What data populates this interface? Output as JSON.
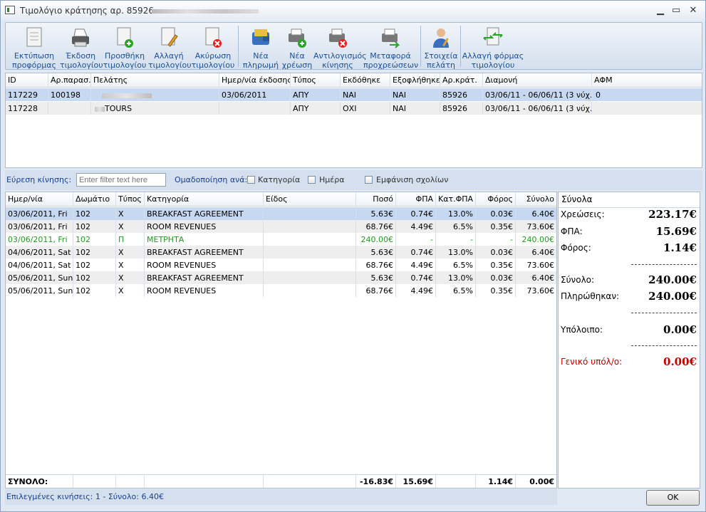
{
  "window": {
    "title": "Τιμολόγιο κράτησης αρ. 85926 -"
  },
  "toolbar": {
    "buttons": [
      {
        "line1": "Εκτύπωση",
        "line2": "προφόρμας"
      },
      {
        "line1": "Έκδοση",
        "line2": "τιμολογίου"
      },
      {
        "line1": "Προσθήκη",
        "line2": "τιμολογίου"
      },
      {
        "line1": "Αλλαγή",
        "line2": "τιμολογίου"
      },
      {
        "line1": "Ακύρωση",
        "line2": "τιμολογίου"
      },
      {
        "line1": "Νέα",
        "line2": "πληρωμή"
      },
      {
        "line1": "Νέα",
        "line2": "χρέωση"
      },
      {
        "line1": "Αντιλογισμός",
        "line2": "κίνησης"
      },
      {
        "line1": "Μεταφορά",
        "line2": "προχρεώσεων"
      },
      {
        "line1": "Στοιχεία",
        "line2": "πελάτη"
      },
      {
        "line1": "Αλλαγή φόρμας",
        "line2": "τιμολογίου"
      }
    ]
  },
  "invoices": {
    "headers": [
      "ID",
      "Αρ.παρασ.",
      "Πελάτης",
      "Ημερ/νία έκδοσης",
      "Τύπος",
      "Εκδόθηκε",
      "Εξοφλήθηκε",
      "Αρ.κράτ.",
      "Διαμονή",
      "ΑΦΜ"
    ],
    "rows": [
      [
        "117229",
        "100198",
        "",
        "03/06/2011",
        "ΑΠΥ",
        "ΝΑΙ",
        "ΝΑΙ",
        "85926",
        "03/06/11 - 06/06/11 (3 νύχ...",
        "0"
      ],
      [
        "117228",
        "",
        "TOURS",
        "",
        "ΑΠΥ",
        "ΟΧΙ",
        "ΝΑΙ",
        "85926",
        "03/06/11 - 06/06/11 (3 νύχ...",
        ""
      ]
    ]
  },
  "filter": {
    "search_label": "Εύρεση κίνησης:",
    "search_placeholder": "Enter filter text here",
    "group_label": "Ομαδοποίηση ανά:",
    "opt_category": "Κατηγορία",
    "opt_day": "Ημέρα",
    "opt_comments": "Εμφάνιση σχολίων"
  },
  "transactions": {
    "headers": [
      "Ημερ/νία",
      "Δωμάτιο",
      "Τύπος",
      "Κατηγορία",
      "Είδος",
      "Ποσό",
      "ΦΠΑ",
      "Κατ.ΦΠΑ",
      "Φόρος",
      "Σύνολο"
    ],
    "rows": [
      [
        "03/06/2011, Fri",
        "102",
        "X",
        "BREAKFAST AGREEMENT",
        "",
        "5.63€",
        "0.74€",
        "13.0%",
        "0.03€",
        "6.40€"
      ],
      [
        "03/06/2011, Fri",
        "102",
        "X",
        "ROOM REVENUES",
        "",
        "68.76€",
        "4.49€",
        "6.5%",
        "0.35€",
        "73.60€"
      ],
      [
        "03/06/2011, Fri",
        "102",
        "Π",
        "ΜΕΤΡΗΤΑ",
        "",
        "240.00€",
        "-",
        "-",
        "-",
        "240.00€"
      ],
      [
        "04/06/2011, Sat",
        "102",
        "X",
        "BREAKFAST AGREEMENT",
        "",
        "5.63€",
        "0.74€",
        "13.0%",
        "0.03€",
        "6.40€"
      ],
      [
        "04/06/2011, Sat",
        "102",
        "X",
        "ROOM REVENUES",
        "",
        "68.76€",
        "4.49€",
        "6.5%",
        "0.35€",
        "73.60€"
      ],
      [
        "05/06/2011, Sun",
        "102",
        "X",
        "BREAKFAST AGREEMENT",
        "",
        "5.63€",
        "0.74€",
        "13.0%",
        "0.03€",
        "6.40€"
      ],
      [
        "05/06/2011, Sun",
        "102",
        "X",
        "ROOM REVENUES",
        "",
        "68.76€",
        "4.49€",
        "6.5%",
        "0.35€",
        "73.60€"
      ]
    ],
    "total": {
      "label": "ΣΥΝΟΛΟ:",
      "amount": "-16.83€",
      "vat": "15.69€",
      "tax": "1.14€",
      "sum": "0.00€"
    }
  },
  "totals": {
    "header": "Σύνολα",
    "charges_label": "Χρεώσεις:",
    "charges": "223.17€",
    "vat_label": "ΦΠΑ:",
    "vat": "15.69€",
    "tax_label": "Φόρος:",
    "tax": "1.14€",
    "sum_label": "Σύνολο:",
    "sum": "240.00€",
    "paid_label": "Πληρώθηκαν:",
    "paid": "240.00€",
    "balance_label": "Υπόλοιπο:",
    "balance": "0.00€",
    "general_label": "Γενικό υπόλ/ο:",
    "general": "0.00€"
  },
  "status": {
    "text": "Επιλεγμένες κινήσεις: 1 - Σύνολο: 6.40€"
  },
  "ok_label": "OK"
}
